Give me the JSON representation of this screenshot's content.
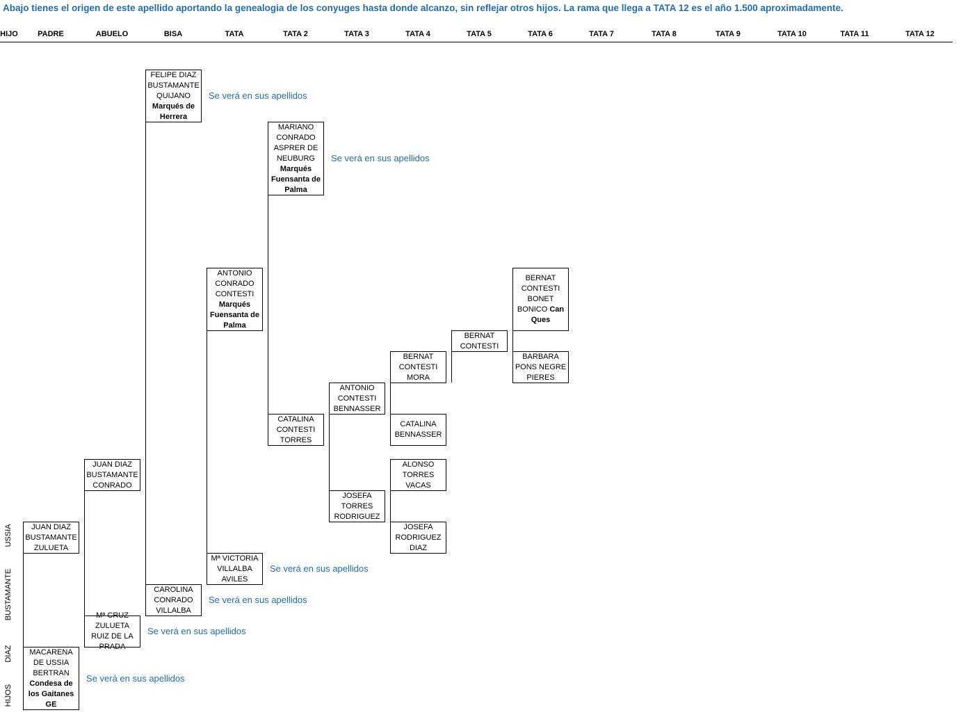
{
  "intro": "Abajo tienes el origen de este apellido aportando la genealogia de los conyuges hasta donde alcanzo, sin reflejar otros hijos. La rama que llega a TATA 12 es el año 1.500 aproximadamente.",
  "headers": [
    "HIJO",
    "PADRE",
    "ABUELO",
    "BISA",
    "TATA",
    "TATA 2",
    "TATA 3",
    "TATA 4",
    "TATA 5",
    "TATA 6",
    "TATA 7",
    "TATA 8",
    "TATA 9",
    "TATA 10",
    "TATA 11",
    "TATA 12"
  ],
  "side_labels": [
    "USSIA",
    "BUSTAMANTE",
    "DIAZ",
    "HIJOS"
  ],
  "note_text": "Se verá en sus apellidos",
  "persons": {
    "juan_diaz_zulueta": {
      "name": "JUAN DIAZ BUSTAMANTE ZULUETA",
      "title": ""
    },
    "macarena": {
      "name": "MACARENA DE USSIA BERTRAN",
      "title": "Condesa de los Gaitanes GE"
    },
    "juan_diaz_conrado": {
      "name": "JUAN DIAZ BUSTAMANTE CONRADO",
      "title": ""
    },
    "m_cruz": {
      "name": "Mª CRUZ ZULUETA RUIZ DE LA PRADA",
      "title": ""
    },
    "felipe": {
      "name": "FELIPE DIAZ BUSTAMANTE QUIJANO",
      "title": "Marqués de Herrera"
    },
    "carolina": {
      "name": "CAROLINA CONRADO VILLALBA",
      "title": ""
    },
    "antonio_conrado": {
      "name": "ANTONIO CONRADO CONTESTI",
      "title": "Marqués Fuensanta de Palma"
    },
    "m_victoria": {
      "name": "Mª VICTORIA VILLALBA AVILES",
      "title": ""
    },
    "mariano": {
      "name": "MARIANO CONRADO ASPRER DE NEUBURG",
      "title": "Marqués Fuensanta de Palma"
    },
    "catalina_contesti": {
      "name": "CATALINA CONTESTI TORRES",
      "title": ""
    },
    "antonio_contesti": {
      "name": "ANTONIO CONTESTI BENNASSER",
      "title": ""
    },
    "josefa_torres": {
      "name": "JOSEFA TORRES RODRIGUEZ",
      "title": ""
    },
    "bernat_mora": {
      "name": "BERNAT CONTESTI MORA",
      "title": ""
    },
    "catalina_bennasser": {
      "name": "CATALINA BENNASSER",
      "title": ""
    },
    "alonso": {
      "name": "ALONSO TORRES VACAS",
      "title": ""
    },
    "josefa_rodriguez": {
      "name": "JOSEFA RODRIGUEZ DIAZ",
      "title": ""
    },
    "bernat_contesti": {
      "name": "BERNAT CONTESTI",
      "title": ""
    },
    "bernat_bonet_name": {
      "name": "BERNAT CONTESTI BONET BONICO",
      "title": "Can Ques"
    },
    "barbara": {
      "name": "BARBARA PONS NEGRE PIERES",
      "title": ""
    }
  }
}
